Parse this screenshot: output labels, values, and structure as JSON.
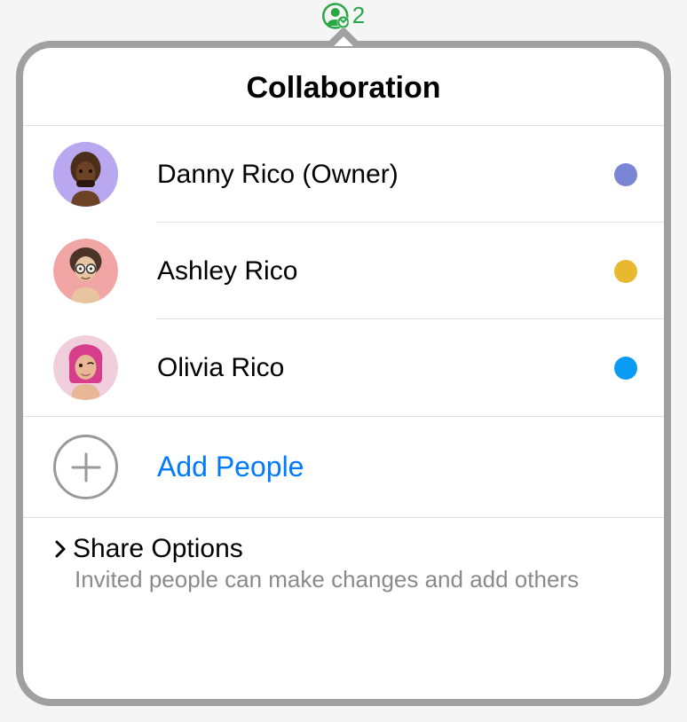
{
  "trigger": {
    "count": "2"
  },
  "popover": {
    "title": "Collaboration",
    "people": [
      {
        "name": "Danny Rico (Owner)",
        "avatarBg": "#b9a8f0",
        "dotColor": "#7b85d6"
      },
      {
        "name": "Ashley Rico",
        "avatarBg": "#f1a5a5",
        "dotColor": "#e8b82e"
      },
      {
        "name": "Olivia Rico",
        "avatarBg": "#f0cedc",
        "dotColor": "#0a9cf5"
      }
    ],
    "addPeople": {
      "label": "Add People"
    },
    "shareOptions": {
      "title": "Share Options",
      "subtitle": "Invited people can make changes and add others"
    }
  }
}
